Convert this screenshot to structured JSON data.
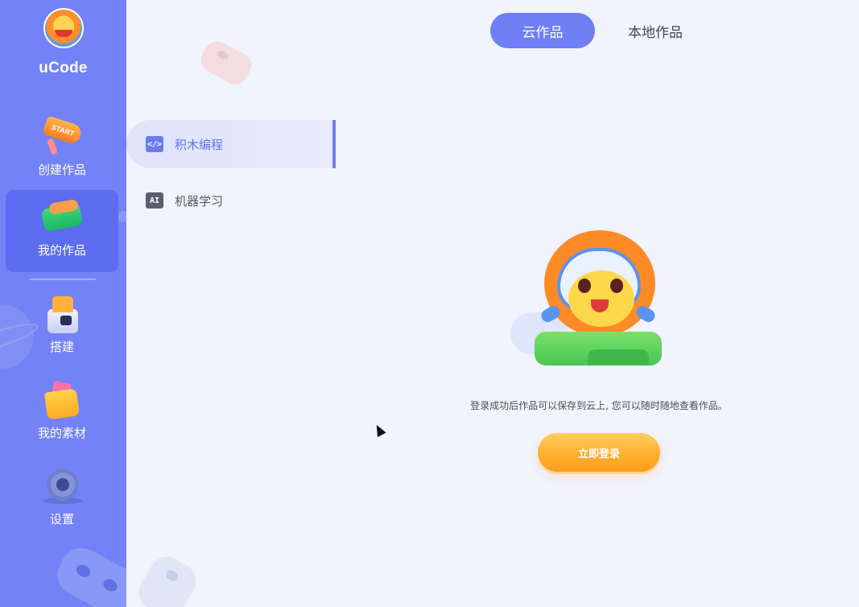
{
  "app": {
    "logo_text": "uCode",
    "logo_icon": "lion-mascot-logo-icon"
  },
  "sidebar": {
    "items": [
      {
        "label": "创建作品",
        "icon": "start-sign-icon",
        "active": false
      },
      {
        "label": "我的作品",
        "icon": "works-bag-icon",
        "active": true
      },
      {
        "label": "搭建",
        "icon": "build-robot-icon",
        "active": false
      },
      {
        "label": "我的素材",
        "icon": "assets-folder-icon",
        "active": false
      },
      {
        "label": "设置",
        "icon": "gear-icon",
        "active": false
      }
    ]
  },
  "categories": [
    {
      "label": "积木编程",
      "icon_glyph": "</>",
      "icon": "code-block-icon",
      "active": true
    },
    {
      "label": "机器学习",
      "icon_glyph": "AI",
      "icon": "ai-icon",
      "active": false
    }
  ],
  "tabs": [
    {
      "label": "云作品",
      "active": true
    },
    {
      "label": "本地作品",
      "active": false
    }
  ],
  "empty_state": {
    "message": "登录成功后作品可以保存到云上, 您可以随时随地查看作品。",
    "login_button": "立即登录",
    "illustration": "lion-astronaut-illustration"
  },
  "colors": {
    "sidebar_bg": "#7382f6",
    "accent": "#6f7ff5",
    "content_bg": "#f1f3fd",
    "login_button": "#ffae2f"
  }
}
